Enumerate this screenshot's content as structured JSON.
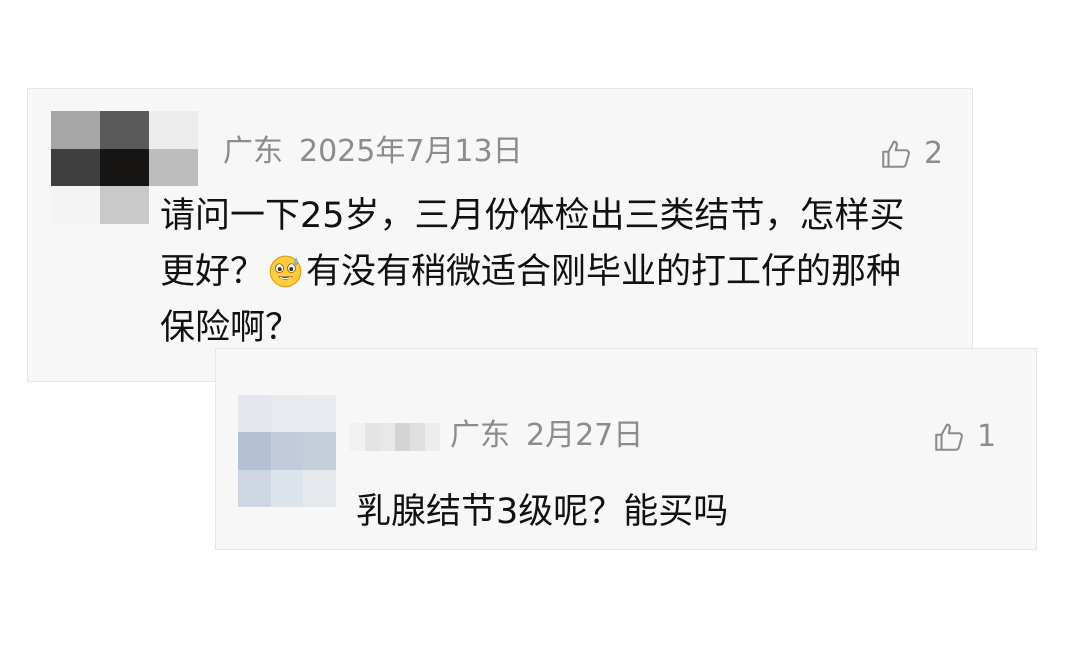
{
  "comments": [
    {
      "location": "广东",
      "date": "2025年7月13日",
      "likes": "2",
      "text_part1": "请问一下25岁，三月份体检出三类结节，怎样买",
      "text_part2_before_emoji": "更好？",
      "emoji_icon": "grinning-sweat-emoji",
      "text_part2_after_emoji": "有没有稍微适合刚毕业的打工仔的那种",
      "text_part3": "保险啊？",
      "avatar_colors": [
        "#a6a6a6",
        "#5a5a5a",
        "#ececec",
        "#3f3f3f",
        "#171514",
        "#bdbdbd",
        "#f4f4f4",
        "#c9c9c9",
        "#f7f7f7"
      ]
    },
    {
      "location": "广东",
      "date": "2月27日",
      "likes": "1",
      "text": "乳腺结节3级呢？能买吗",
      "avatar_colors": [
        "#e4e8ee",
        "#e7ebf0",
        "#e8ecf0",
        "#b4c0d4",
        "#c1cbdb",
        "#c5cfda",
        "#ced6e2",
        "#dde3ea",
        "#e5e8ec"
      ],
      "name_blur_colors": [
        "#f1f1f1",
        "#e4e4e4",
        "#e8e8e8",
        "#d4d4d4",
        "#e0e0e0",
        "#ededed"
      ]
    }
  ],
  "icons": {
    "like_icon": "thumbs-up-icon"
  },
  "colors": {
    "card_background": "#f7f7f7",
    "card_border": "#e6e6e6",
    "meta_text": "#8c8c8c",
    "body_text": "#111111"
  }
}
